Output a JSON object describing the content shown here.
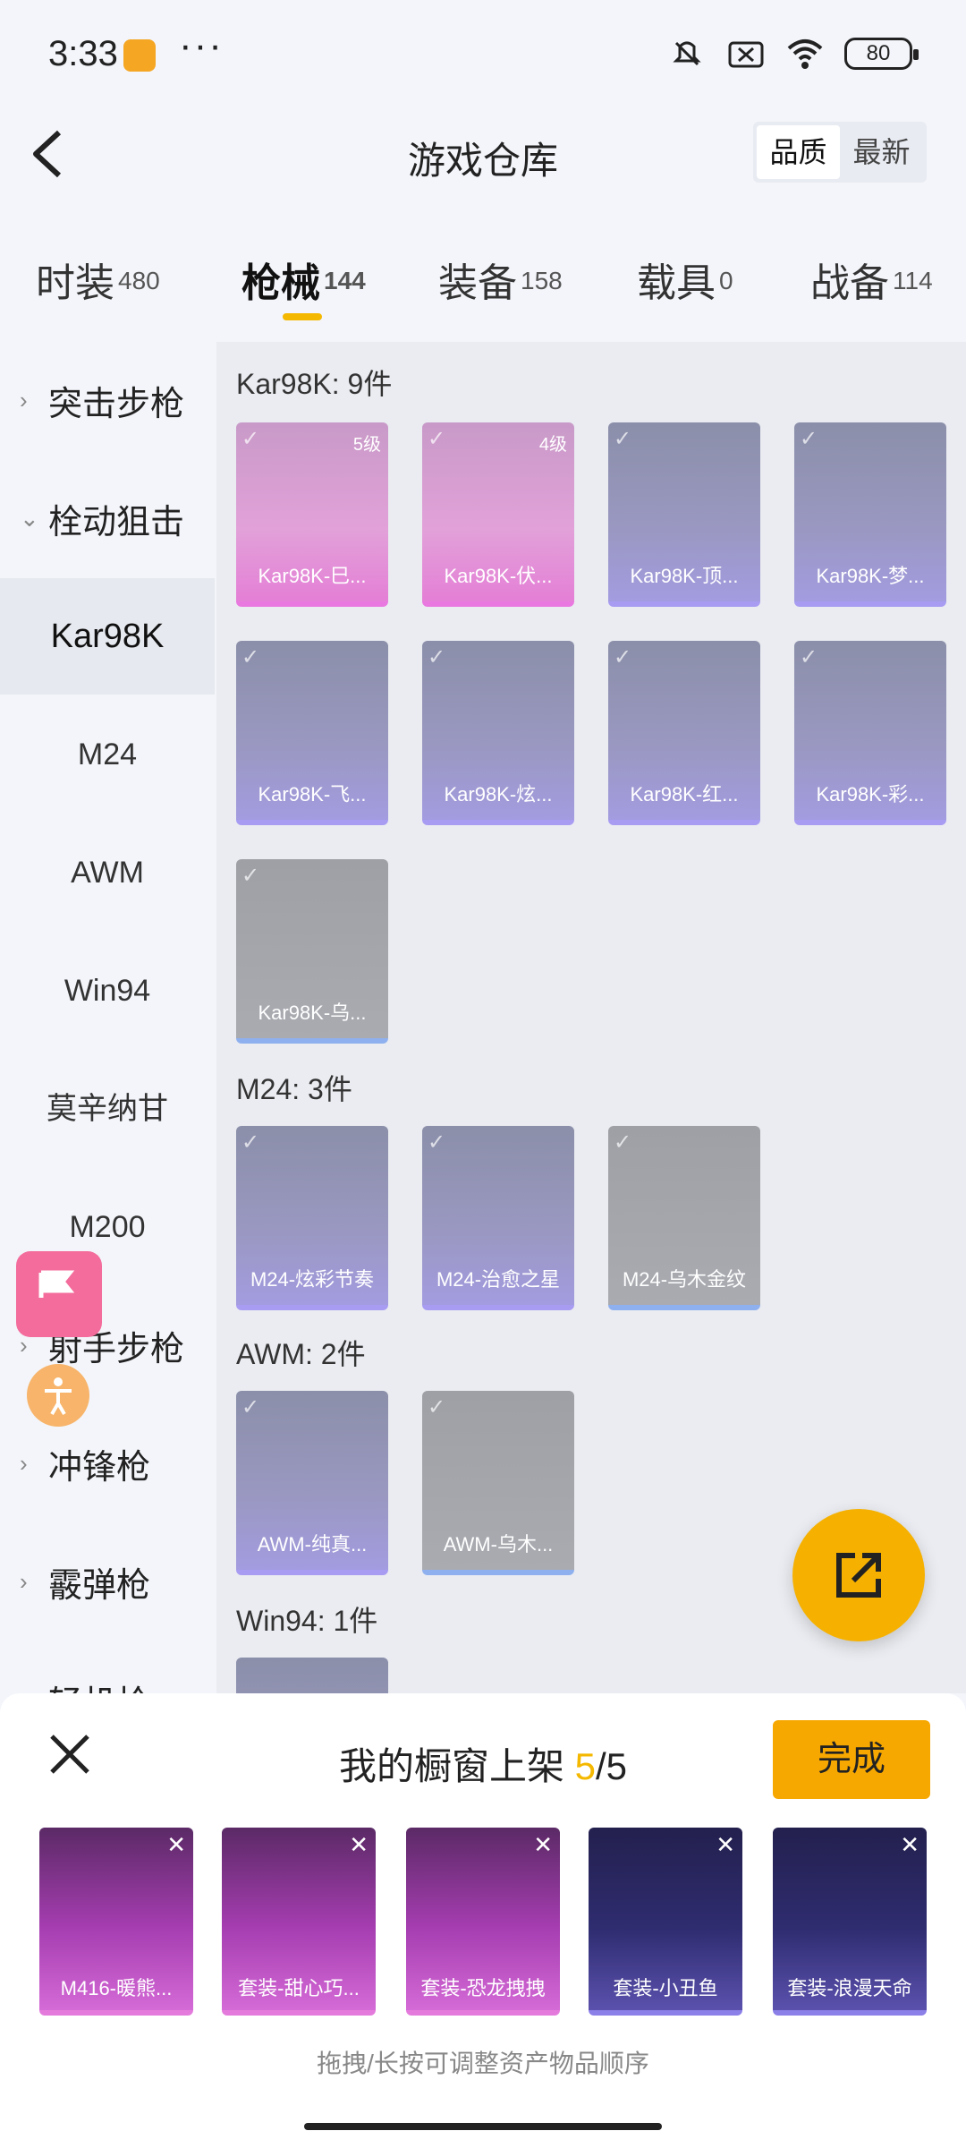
{
  "status_bar": {
    "time": "3:33",
    "dots": "···",
    "battery": "80"
  },
  "header": {
    "title": "游戏仓库",
    "sort": [
      "品质",
      "最新"
    ]
  },
  "tabs": [
    {
      "label": "时装",
      "count": "480"
    },
    {
      "label": "枪械",
      "count": "144"
    },
    {
      "label": "装备",
      "count": "158"
    },
    {
      "label": "载具",
      "count": "0"
    },
    {
      "label": "战备",
      "count": "114"
    }
  ],
  "sidebar": {
    "cat1": "突击步枪",
    "cat2": "栓动狙击",
    "subs": [
      "Kar98K",
      "M24",
      "AWM",
      "Win94",
      "莫辛纳甘",
      "M200"
    ],
    "cat3": "射手步枪",
    "cat4": "冲锋枪",
    "cat5": "霰弹枪",
    "cat6": "轻机枪"
  },
  "groups": {
    "kar": {
      "title": "Kar98K: 9件",
      "items": [
        {
          "name": "Kar98K-巳...",
          "level": "5级"
        },
        {
          "name": "Kar98K-伏...",
          "level": "4级"
        },
        {
          "name": "Kar98K-顶..."
        },
        {
          "name": "Kar98K-梦..."
        },
        {
          "name": "Kar98K-飞..."
        },
        {
          "name": "Kar98K-炫..."
        },
        {
          "name": "Kar98K-红..."
        },
        {
          "name": "Kar98K-彩..."
        },
        {
          "name": "Kar98K-乌..."
        }
      ]
    },
    "m24": {
      "title": "M24: 3件",
      "items": [
        {
          "name": "M24-炫彩节奏"
        },
        {
          "name": "M24-治愈之星"
        },
        {
          "name": "M24-乌木金纹"
        }
      ]
    },
    "awm": {
      "title": "AWM: 2件",
      "items": [
        {
          "name": "AWM-纯真..."
        },
        {
          "name": "AWM-乌木..."
        }
      ]
    },
    "win94": {
      "title": "Win94: 1件"
    }
  },
  "panel": {
    "title": "我的橱窗上架",
    "current": "5",
    "slash_total": "/5",
    "done": "完成",
    "items": [
      {
        "name": "M416-暖熊..."
      },
      {
        "name": "套装-甜心巧..."
      },
      {
        "name": "套装-恐龙拽拽"
      },
      {
        "name": "套装-小丑鱼"
      },
      {
        "name": "套装-浪漫天命"
      }
    ],
    "hint": "拖拽/长按可调整资产物品顺序"
  },
  "colors": {
    "accent": "#f6a800",
    "indicator": "#f5b800",
    "pink": "#e979e0",
    "purple": "#a79cf2"
  }
}
